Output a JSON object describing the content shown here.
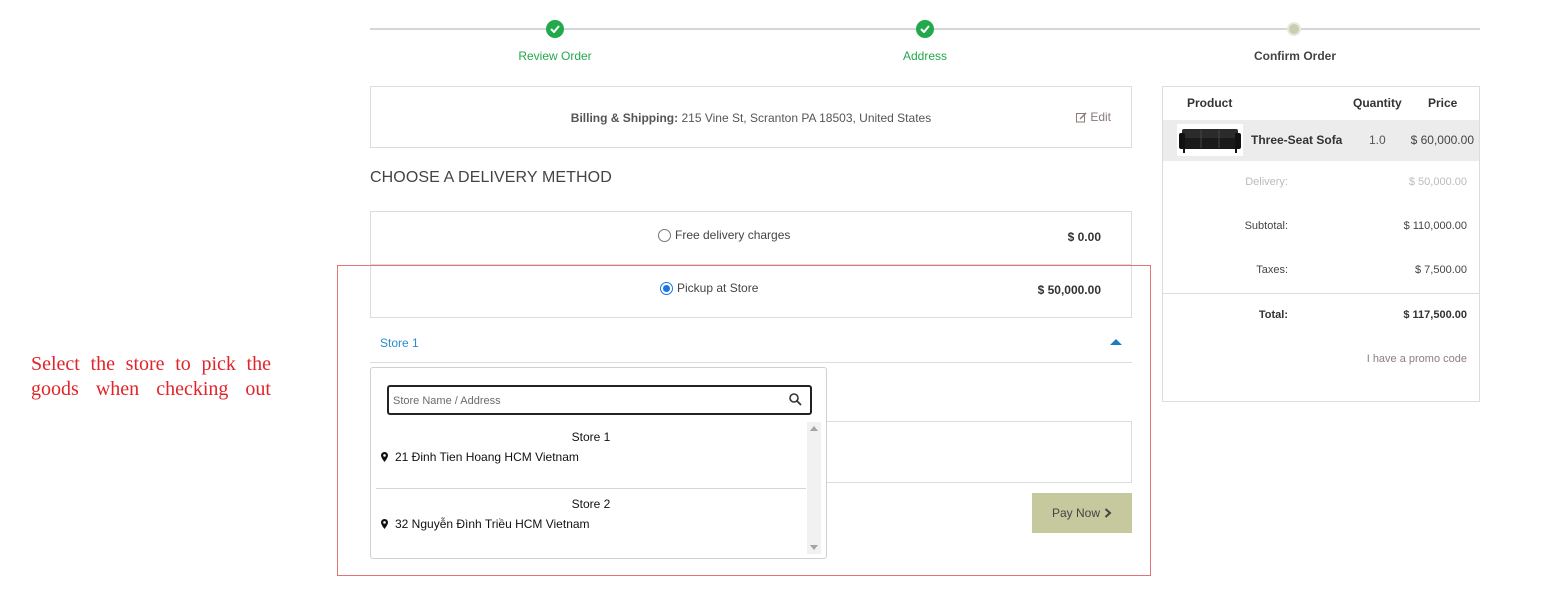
{
  "annotation": {
    "text": "Select the store to pick the goods when checking out"
  },
  "steps": [
    {
      "label": "Review Order",
      "state": "done"
    },
    {
      "label": "Address",
      "state": "done"
    },
    {
      "label": "Confirm Order",
      "state": "current"
    }
  ],
  "address": {
    "label": "Billing & Shipping:",
    "value": "215 Vine St, Scranton PA 18503, United States",
    "edit_label": "Edit"
  },
  "delivery": {
    "title": "CHOOSE A DELIVERY METHOD",
    "options": [
      {
        "label": "Free delivery charges",
        "price": "$ 0.00",
        "selected": false
      },
      {
        "label": "Pickup at Store",
        "price": "$ 50,000.00",
        "selected": true
      }
    ],
    "store_select": {
      "selected": "Store 1"
    },
    "search": {
      "placeholder": "Store Name / Address"
    },
    "stores": [
      {
        "name": "Store 1",
        "address": "21 Đinh Tien Hoang HCM Vietnam"
      },
      {
        "name": "Store 2",
        "address": "32 Nguyễn Đình Triều HCM Vietnam"
      }
    ]
  },
  "pay_now": {
    "label": "Pay Now"
  },
  "summary": {
    "headers": {
      "product": "Product",
      "quantity": "Quantity",
      "price": "Price"
    },
    "product": {
      "name": "Three-Seat Sofa",
      "quantity": "1.0",
      "price": "$ 60,000.00"
    },
    "delivery": {
      "label": "Delivery:",
      "value": "$ 50,000.00"
    },
    "subtotal": {
      "label": "Subtotal:",
      "value": "$ 110,000.00"
    },
    "taxes": {
      "label": "Taxes:",
      "value": "$ 7,500.00"
    },
    "total": {
      "label": "Total:",
      "value": "$ 117,500.00"
    },
    "promo_label": "I have a promo code"
  },
  "colors": {
    "step_done": "#22a94b",
    "link": "#2a8ccb",
    "pay_button": "#c6c89d",
    "annotation": "#e0242a",
    "highlight_border": "#e57373"
  }
}
